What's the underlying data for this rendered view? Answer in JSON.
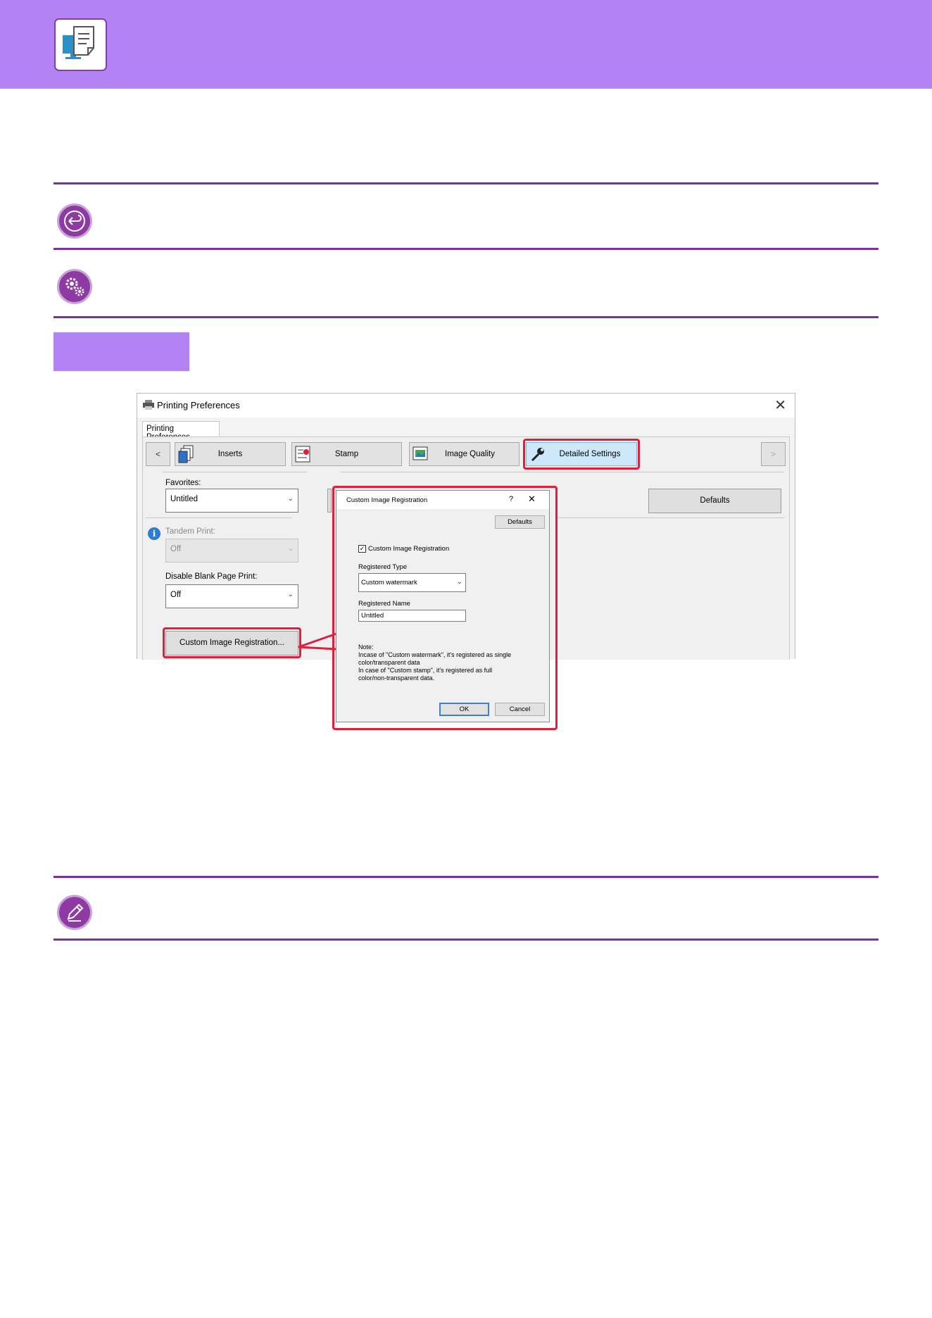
{
  "window": {
    "title": "Printing Preferences",
    "close_glyph": "✕",
    "outer_tab": "Printing Preferences",
    "nav_prev": "<",
    "nav_next": ">",
    "tabs": {
      "inserts": "Inserts",
      "stamp": "Stamp",
      "image_quality": "Image Quality",
      "detailed_settings": "Detailed Settings"
    },
    "favorites_label": "Favorites:",
    "favorites_value": "Untitled",
    "defaults_button": "Defaults",
    "tandem_print_label": "Tandem Print:",
    "tandem_print_value": "Off",
    "disable_blank_label": "Disable Blank Page Print:",
    "disable_blank_value": "Off",
    "custom_image_button": "Custom Image Registration..."
  },
  "dialog": {
    "title": "Custom Image Registration",
    "help_glyph": "?",
    "close_glyph": "✕",
    "defaults_button": "Defaults",
    "checkbox_label": "Custom Image Registration",
    "registered_type_label": "Registered Type",
    "registered_type_value": "Custom watermark",
    "registered_name_label": "Registered Name",
    "registered_name_value": "Untitled",
    "note_lines": [
      "Note:",
      "Incase of \"Custom watermark\", it's registered as single",
      "color/transparent data",
      "In case of \"Custom stamp\", it's registered as full",
      "color/non-transparent data."
    ],
    "ok_button": "OK",
    "cancel_button": "Cancel"
  },
  "colors": {
    "accent_purple": "#b283f2",
    "rule_purple": "#7a2fa3",
    "highlight_red": "#e0203b"
  },
  "icons": [
    "printer-document-icon",
    "return-icon",
    "settings-gears-icon",
    "pencil-note-icon"
  ]
}
